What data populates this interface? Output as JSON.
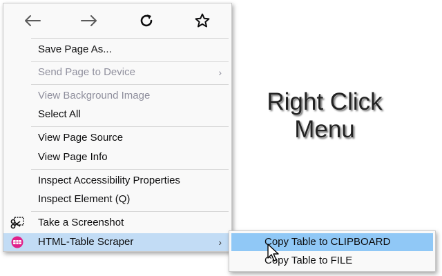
{
  "nav": {
    "back_icon": "arrow-left-icon",
    "forward_icon": "arrow-right-icon",
    "reload_icon": "reload-icon",
    "bookmark_icon": "star-icon"
  },
  "menu": {
    "save_page_as": "Save Page As...",
    "send_page_to_device": "Send Page to Device",
    "view_background_image": "View Background Image",
    "select_all": "Select All",
    "view_page_source": "View Page Source",
    "view_page_info": "View Page Info",
    "inspect_accessibility": "Inspect Accessibility Properties",
    "inspect_element": "Inspect Element (Q)",
    "take_screenshot": "Take a Screenshot",
    "html_table_scraper": "HTML-Table Scraper",
    "submenu_arrow": "›"
  },
  "submenu": {
    "copy_to_clipboard": "Copy Table to CLIPBOARD",
    "copy_to_file": "Copy Table to FILE"
  },
  "annotation": {
    "line1": "Right Click",
    "line2": "Menu"
  },
  "colors": {
    "menu_bg": "#f9f9f9",
    "highlight": "#c2dcf5",
    "submenu_active": "#90c8f6",
    "disabled_text": "#8f8f9d"
  }
}
